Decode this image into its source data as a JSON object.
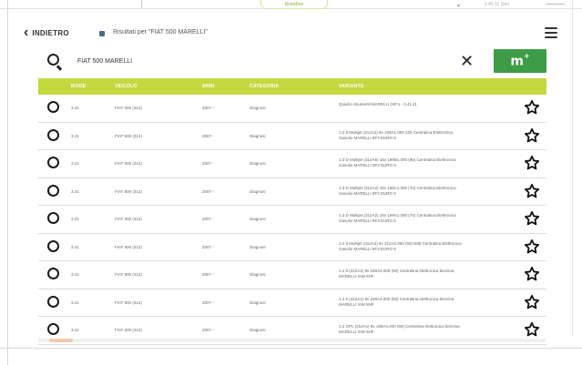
{
  "statusbar": {
    "brand": "BrainBee",
    "time": "1:45 11 Gen"
  },
  "header": {
    "back_label": "INDIETRO",
    "breadcrumb": "Risultati per \"FIAT 500 MARELLI\""
  },
  "search": {
    "value": "FIAT 500 MARELLI"
  },
  "table": {
    "columns": [
      "MODE",
      "VEICOLO",
      "ANNI",
      "CATEGORIA",
      "VARIANTE"
    ],
    "rows": [
      {
        "mode": "3.41",
        "vehicle": "FIAT 500 (312)",
        "years": "2007 -",
        "category": "Diagnosi",
        "variant": "Quadro strumenti MARELLI (SP.1 - 3.41.8)"
      },
      {
        "mode": "3.41",
        "vehicle": "FIAT 500 (312)",
        "years": "2007 -",
        "category": "Diagnosi",
        "variant": "1.2 8 Multijet (312A2) 8v 169A1.000 229 Centralina Elettronica Gasolio MARELLI 8F3 EURO 5"
      },
      {
        "mode": "3.41",
        "vehicle": "FIAT 500 (312)",
        "years": "2007 -",
        "category": "Diagnosi",
        "variant": "1.3 D Multijet (312A5) 16v 199B1.000 (95) Centralina Elettronica Gasolio MARELLI 8F3 EURO 5"
      },
      {
        "mode": "3.41",
        "vehicle": "FIAT 500 (312)",
        "years": "2007 -",
        "category": "Diagnosi",
        "variant": "1.3 D Multijet (312A2) 16v 169A1.000 (75) Centralina Elettronica Gasolio MARELLI 8F3 EURO 5"
      },
      {
        "mode": "3.41",
        "vehicle": "FIAT 500 (312)",
        "years": "2007 -",
        "category": "Diagnosi",
        "variant": "1.3 D Multijet (312A2) 16v 169A1.000 (75) Centralina Elettronica Gasolio MARELLI 8F3 EURO 5"
      },
      {
        "mode": "3.41",
        "vehicle": "FIAT 500 (312)",
        "years": "2007 -",
        "category": "Diagnosi",
        "variant": "1.2 8 Multijet (312A2) 8v 312A2.000 (69) E95 Centralina Elettronica Gasolio MARELLI 8F3 EURO 5"
      },
      {
        "mode": "3.41",
        "vehicle": "FIAT 500 (312)",
        "years": "2007 -",
        "category": "Diagnosi",
        "variant": "1.2 8 (312A1) 8v 169A4.000 (69) Centralina elettronica benzina MARELLI IAW 8HF"
      },
      {
        "mode": "3.41",
        "vehicle": "FIAT 500 (312)",
        "years": "2007 -",
        "category": "Diagnosi",
        "variant": "1.2 8 (312A1) 8v 169A4.000 (69) Centralina elettronica benzina MARELLI IAW 8HF"
      },
      {
        "mode": "3.41",
        "vehicle": "FIAT 500 (312)",
        "years": "2007 -",
        "category": "Diagnosi",
        "variant": "1.2 GPL (312A1) 8v 169A4.000 (69) Centralina elettronica benzina MARELLI IAW 8HF"
      }
    ]
  },
  "colors": {
    "accent_green": "#3d9c45",
    "header_lime": "#c3d940"
  },
  "icons": {
    "back": "chevron-left-icon",
    "crumb": "folder-icon",
    "menu": "hamburger-menu-icon",
    "search": "search-icon",
    "clear": "close-icon",
    "add": "add-entry-icon",
    "radio": "radio-icon",
    "favorite": "star-outline-icon"
  }
}
